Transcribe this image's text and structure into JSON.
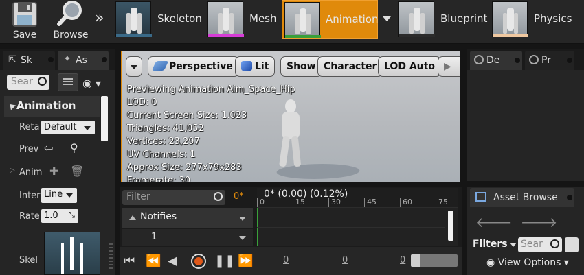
{
  "toolbar": {
    "save_label": "Save",
    "browse_label": "Browse",
    "modes": [
      {
        "label": "Skeleton",
        "accent": "#3a6a88"
      },
      {
        "label": "Mesh",
        "accent": "#d63cd6"
      },
      {
        "label": "Animation",
        "accent": "#e08a0b"
      },
      {
        "label": "Blueprint",
        "accent": "#2b2b2b"
      },
      {
        "label": "Physics",
        "accent": "#f0c8a0"
      }
    ]
  },
  "left_panel": {
    "tabs": [
      {
        "label": "Skeleton Tree"
      },
      {
        "label": "Asset Details"
      }
    ],
    "tab_labels_visible": [
      "Sk",
      "As"
    ],
    "search_placeholder": "Sear",
    "section_title": "Animation",
    "properties": {
      "retarget_label": "Reta",
      "retarget_value": "Default",
      "preview_label": "Prev",
      "anim_label": "Anim",
      "interp_label": "Inter",
      "interp_value": "Line",
      "rate_label": "Rate",
      "rate_value": "1.0",
      "skel_label": "Skel"
    }
  },
  "viewport": {
    "buttons": {
      "perspective": "Perspective",
      "lit": "Lit",
      "show": "Show",
      "character": "Character",
      "lod": "LOD Auto"
    },
    "stats": [
      "Previewing Animation Aim_Space_Hip",
      "LOD: 0",
      "Current Screen Size: 1.023",
      "Triangles: 41,052",
      "Vertices: 23,297",
      "UV Channels: 1",
      "Approx Size: 277x79x283",
      "Framerate: 30"
    ]
  },
  "right_panel": {
    "details_tab": "De",
    "preview_tab": "Pr",
    "asset_browser_tab": "Asset Browse",
    "filters_label": "Filters",
    "search_placeholder": "Sear",
    "view_options_label": "View Options"
  },
  "timeline": {
    "filter_placeholder": "Filter",
    "frame_indicator": "0*",
    "playhead_text": "0* (0.00) (0.12%)",
    "ticks": [
      "0",
      "15",
      "30",
      "45",
      "60",
      "75"
    ],
    "notifies_label": "Notifies",
    "track_number": "1",
    "transport_values": [
      "0",
      "0",
      "0"
    ]
  }
}
